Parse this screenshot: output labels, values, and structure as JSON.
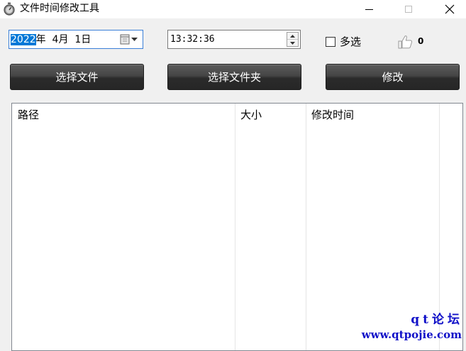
{
  "window": {
    "title": "文件时间修改工具"
  },
  "date_picker": {
    "year_part": "2022",
    "rest_part": "年  4月  1日"
  },
  "time_picker": {
    "value": "13:32:36"
  },
  "multi_select": {
    "label": "多选",
    "checked": false
  },
  "like": {
    "count": "0"
  },
  "buttons": {
    "select_file": "选择文件",
    "select_folder": "选择文件夹",
    "modify": "修改"
  },
  "file_list": {
    "columns": [
      "路径",
      "大小",
      "修改时间"
    ],
    "rows": []
  },
  "watermark": {
    "line1": "qt论坛",
    "line2": "www.qtpojie.com"
  }
}
